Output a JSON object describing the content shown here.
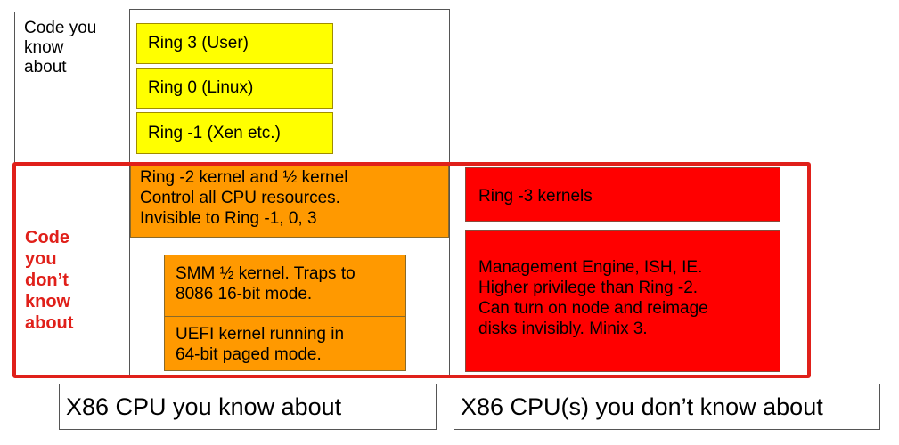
{
  "left_label": [
    "Code you",
    "know",
    "about"
  ],
  "rings": [
    "Ring 3 (User)",
    "Ring 0 (Linux)",
    "Ring -1 (Xen etc.)"
  ],
  "ring2_block": [
    "Ring -2 kernel and ½ kernel",
    "Control all CPU resources.",
    "Invisible to Ring -1, 0, 3"
  ],
  "smm_block": [
    "SMM ½ kernel. Traps to",
    "8086 16-bit mode."
  ],
  "uefi_block": [
    "UEFI kernel running in",
    "64-bit paged mode."
  ],
  "dont_know_label": [
    "Code",
    "you",
    "don’t",
    "know",
    "about"
  ],
  "ring3_kernels": "Ring -3 kernels",
  "management_block": [
    "Management Engine, ISH, IE.",
    "Higher privilege than Ring -2.",
    "Can turn on node and reimage",
    "disks invisibly. Minix 3."
  ],
  "bottom_left": "X86 CPU you know about",
  "bottom_right": "X86 CPU(s) you don’t know about",
  "colors": {
    "yellow": "#ffff00",
    "orange": "#ff9900",
    "red": "#ff0000",
    "frame_red": "#e0201a"
  }
}
